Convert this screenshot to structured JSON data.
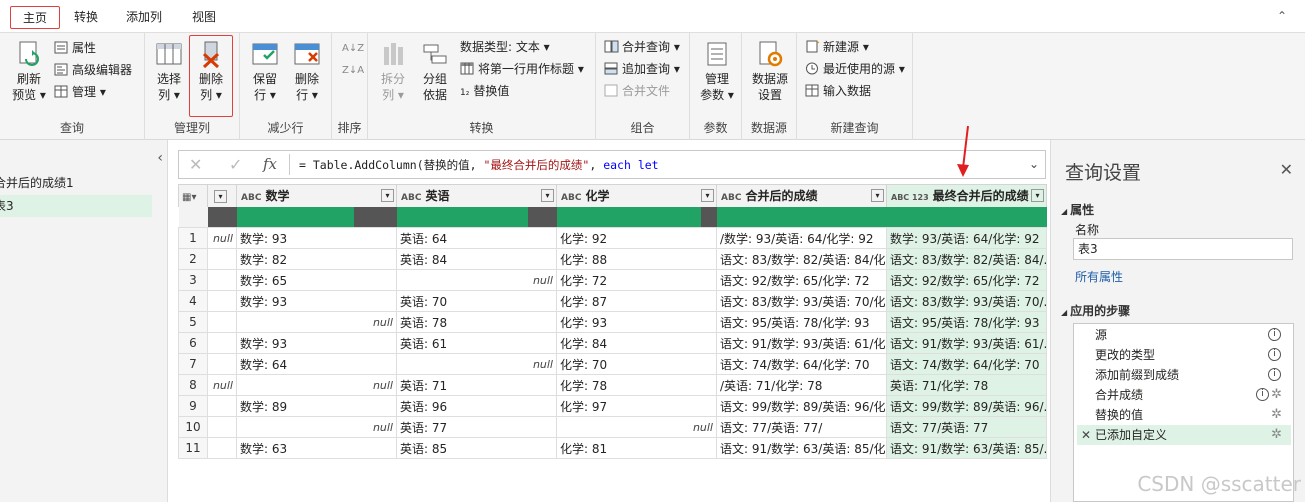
{
  "tabs": [
    "主页",
    "转换",
    "添加列",
    "视图"
  ],
  "ribbon": {
    "query": {
      "label": "查询",
      "refresh": "刷新",
      "preview": "预览",
      "properties": "属性",
      "advanced_editor": "高级编辑器",
      "manage": "管理"
    },
    "manage_cols": {
      "label": "管理列",
      "choose": "选择",
      "choose2": "列",
      "remove": "删除",
      "remove2": "列"
    },
    "reduce_rows": {
      "label": "减少行",
      "keep": "保留",
      "keep2": "行",
      "remove": "删除",
      "remove2": "行"
    },
    "sort": {
      "label": "排序"
    },
    "transform": {
      "label": "转换",
      "split": "拆分",
      "split2": "列",
      "group": "分组",
      "group2": "依据",
      "data_type": "数据类型: 文本",
      "first_row": "将第一行用作标题",
      "replace": "替换值"
    },
    "combine": {
      "label": "组合",
      "merge": "合并查询",
      "append": "追加查询",
      "files": "合并文件"
    },
    "params": {
      "label": "参数",
      "manage": "管理",
      "manage2": "参数"
    },
    "datasource": {
      "label": "数据源",
      "settings": "数据源",
      "settings2": "设置"
    },
    "newquery": {
      "label": "新建查询",
      "new_source": "新建源",
      "recent": "最近使用的源",
      "enter": "输入数据"
    }
  },
  "left": {
    "items": [
      "合并后的成绩1",
      "表3"
    ]
  },
  "formula": {
    "text_plain": "= Table.AddColumn(替换的值, ",
    "text_string": "\"最终合并后的成绩\"",
    "text_sep": ", ",
    "text_kw": "each let"
  },
  "columns": [
    {
      "type": "ABC",
      "name": "数学"
    },
    {
      "type": "ABC",
      "name": "英语"
    },
    {
      "type": "ABC",
      "name": "化学"
    },
    {
      "type": "ABC",
      "name": "合并后的成绩"
    },
    {
      "type": "ABC 123",
      "name": "最终合并后的成绩"
    }
  ],
  "rows": [
    {
      "n": "1",
      "c0": "null",
      "c1": "数学: 93",
      "c2": "英语: 64",
      "c3": "化学: 92",
      "c4": "/数学: 93/英语: 64/化学: 92",
      "c5": "数学: 93/英语: 64/化学: 92"
    },
    {
      "n": "2",
      "c0": "",
      "c1": "数学: 82",
      "c2": "英语: 84",
      "c3": "化学: 88",
      "c4": "语文: 83/数学: 82/英语: 84/化...",
      "c5": "语文: 83/数学: 82/英语: 84/..."
    },
    {
      "n": "3",
      "c0": "",
      "c1": "数学: 65",
      "c2": "null",
      "c3": "化学: 72",
      "c4": "语文: 92/数学: 65/化学: 72",
      "c5": "语文: 92/数学: 65/化学: 72"
    },
    {
      "n": "4",
      "c0": "",
      "c1": "数学: 93",
      "c2": "英语: 70",
      "c3": "化学: 87",
      "c4": "语文: 83/数学: 93/英语: 70/化...",
      "c5": "语文: 83/数学: 93/英语: 70/..."
    },
    {
      "n": "5",
      "c0": "",
      "c1": "null",
      "c2": "英语: 78",
      "c3": "化学: 93",
      "c4": "语文: 95/英语: 78/化学: 93",
      "c5": "语文: 95/英语: 78/化学: 93"
    },
    {
      "n": "6",
      "c0": "",
      "c1": "数学: 93",
      "c2": "英语: 61",
      "c3": "化学: 84",
      "c4": "语文: 91/数学: 93/英语: 61/化...",
      "c5": "语文: 91/数学: 93/英语: 61/..."
    },
    {
      "n": "7",
      "c0": "",
      "c1": "数学: 64",
      "c2": "null",
      "c3": "化学: 70",
      "c4": "语文: 74/数学: 64/化学: 70",
      "c5": "语文: 74/数学: 64/化学: 70"
    },
    {
      "n": "8",
      "c0": "null",
      "c1": "null",
      "c2": "英语: 71",
      "c3": "化学: 78",
      "c4": "/英语: 71/化学: 78",
      "c5": "英语: 71/化学: 78"
    },
    {
      "n": "9",
      "c0": "",
      "c1": "数学: 89",
      "c2": "英语: 96",
      "c3": "化学: 97",
      "c4": "语文: 99/数学: 89/英语: 96/化...",
      "c5": "语文: 99/数学: 89/英语: 96/..."
    },
    {
      "n": "10",
      "c0": "",
      "c1": "null",
      "c2": "英语: 77",
      "c3": "null",
      "c4": "语文: 77/英语: 77/",
      "c5": "语文: 77/英语: 77"
    },
    {
      "n": "11",
      "c0": "",
      "c1": "数学: 63",
      "c2": "英语: 85",
      "c3": "化学: 81",
      "c4": "语文: 91/数学: 63/英语: 85/化...",
      "c5": "语文: 91/数学: 63/英语: 85/..."
    }
  ],
  "right": {
    "title": "查询设置",
    "props_header": "属性",
    "name_label": "名称",
    "name_value": "表3",
    "all_props": "所有属性",
    "steps_header": "应用的步骤",
    "steps": [
      "源",
      "更改的类型",
      "添加前缀到成绩",
      "合并成绩",
      "替换的值",
      "已添加自定义"
    ]
  },
  "watermark": "CSDN @sscatter",
  "colors": {
    "accent": "#21a366",
    "selected": "#dff2e6",
    "highlight": "#e04040",
    "arrow": "#e02020"
  }
}
